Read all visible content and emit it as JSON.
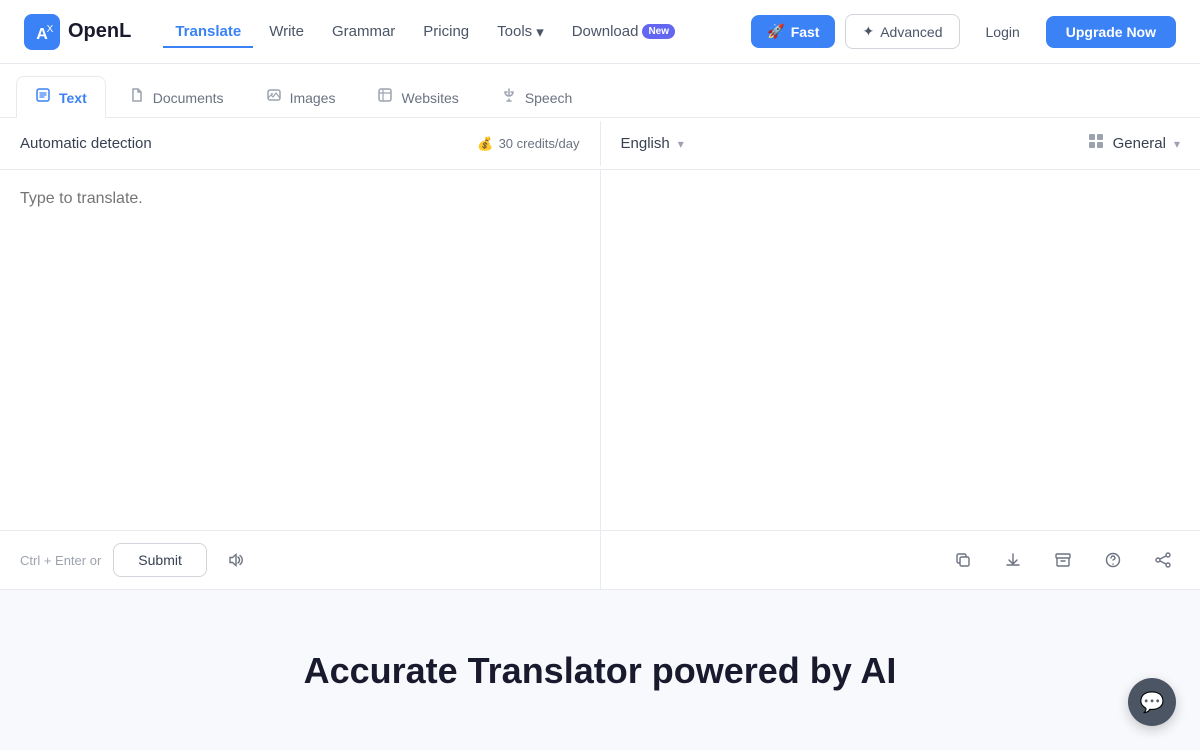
{
  "logo": {
    "text": "OpenL"
  },
  "navbar": {
    "links": [
      {
        "id": "translate",
        "label": "Translate",
        "active": true
      },
      {
        "id": "write",
        "label": "Write",
        "active": false
      },
      {
        "id": "grammar",
        "label": "Grammar",
        "active": false
      },
      {
        "id": "pricing",
        "label": "Pricing",
        "active": false
      },
      {
        "id": "tools",
        "label": "Tools",
        "active": false,
        "hasChevron": true
      },
      {
        "id": "download",
        "label": "Download",
        "active": false,
        "badge": "New"
      }
    ],
    "fast_label": "Fast",
    "advanced_label": "Advanced",
    "login_label": "Login",
    "upgrade_label": "Upgrade Now"
  },
  "tabs": [
    {
      "id": "text",
      "label": "Text",
      "active": true
    },
    {
      "id": "documents",
      "label": "Documents",
      "active": false
    },
    {
      "id": "images",
      "label": "Images",
      "active": false
    },
    {
      "id": "websites",
      "label": "Websites",
      "active": false
    },
    {
      "id": "speech",
      "label": "Speech",
      "active": false
    }
  ],
  "translator": {
    "auto_detect_label": "Automatic detection",
    "credits_label": "30 credits/day",
    "target_language": "English",
    "style_label": "General",
    "source_placeholder": "Type to translate.",
    "submit_label": "Submit",
    "shortcut_hint": "Ctrl + Enter or",
    "icons": {
      "copy": "copy-icon",
      "download": "download-icon",
      "archive": "archive-icon",
      "help": "help-icon",
      "share": "share-icon",
      "speaker": "speaker-icon"
    }
  },
  "hero": {
    "title": "Accurate Translator powered by AI"
  }
}
